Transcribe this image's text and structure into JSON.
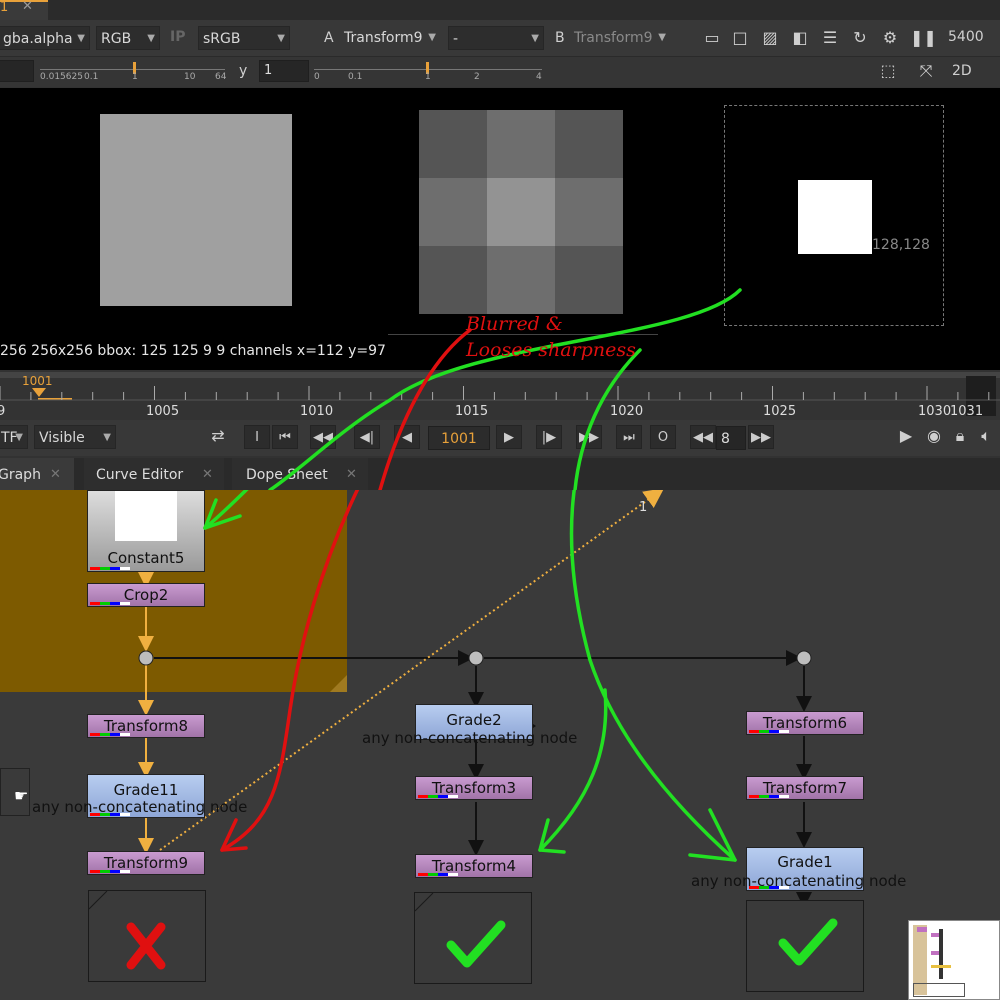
{
  "tab": {
    "number": "1",
    "close": "✕"
  },
  "toolbar": {
    "channels": "gba.alpha",
    "rgb": "RGB",
    "ip": "IP",
    "colorspace": "sRGB",
    "a_label": "A",
    "a_input": "Transform9",
    "dash": "-",
    "b_label": "B",
    "b_input": "Transform9",
    "frame_count": "5400"
  },
  "toolbar2": {
    "gain_ticks": [
      "0.015625",
      "0.1",
      "1",
      "10",
      "64"
    ],
    "gamma_label": "y",
    "gamma_value": "1",
    "gamma_ticks": [
      "0",
      "0.1",
      "1",
      "2",
      "4"
    ],
    "mode_2d": "2D"
  },
  "viewer": {
    "coord_label": "128,128",
    "info": "256 256x256  bbox: 125 125 9 9 channels  x=112 y=97",
    "annotation_red": "Blurred &\nLooses sharpness"
  },
  "timeline": {
    "current_frame": "1001",
    "ticks": [
      "9",
      "1005",
      "1010",
      "1015",
      "1020",
      "1025",
      "1030",
      "1031"
    ]
  },
  "playbar": {
    "tf": "TF",
    "visible": "Visible",
    "frame": "1001",
    "step": "8",
    "i_label": "I",
    "o_label": "O"
  },
  "panels": {
    "tabs": [
      "Graph",
      "Curve Editor",
      "Dope Sheet"
    ]
  },
  "nodes": {
    "constant5": "Constant5",
    "crop2": "Crop2",
    "transform8": "Transform8",
    "grade11": "Grade11",
    "transform9": "Transform9",
    "grade2": "Grade2",
    "transform3": "Transform3",
    "transform4": "Transform4",
    "transform6": "Transform6",
    "transform7": "Transform7",
    "grade1": "Grade1",
    "note": "any non-concatenating node",
    "dot_label": "1"
  },
  "colors": {
    "accent": "#e8a13a",
    "backdrop": "#7d5a00",
    "annotation_red": "#e01010",
    "annotation_green": "#22e022",
    "node_purple": "#b585bc",
    "node_blue": "#a3b9e4"
  }
}
